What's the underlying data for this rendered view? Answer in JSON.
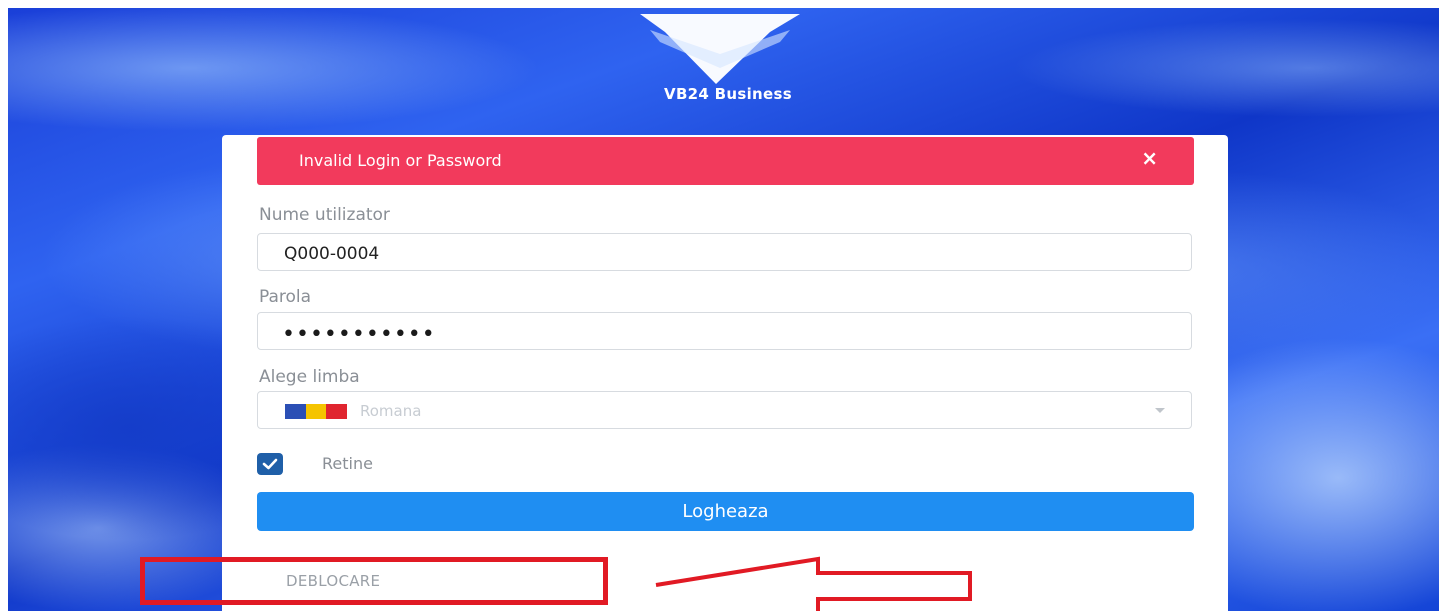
{
  "brand": {
    "name": "VB24 Business"
  },
  "alert": {
    "message": "Invalid Login or Password",
    "close_symbol": "×"
  },
  "form": {
    "username": {
      "label": "Nume utilizator",
      "value": "Q000-0004"
    },
    "password": {
      "label": "Parola",
      "masked_value": "•••••••••••"
    },
    "language": {
      "label": "Alege limba",
      "selected": "Romana",
      "flag_colors": [
        "#2b4fb5",
        "#f5c400",
        "#e0252f"
      ]
    },
    "remember": {
      "label": "Retine",
      "checked": true
    },
    "submit_label": "Logheaza",
    "unlock_link": "DEBLOCARE"
  },
  "colors": {
    "alert": "#f23a5c",
    "primary_button": "#1f8ef2",
    "checkbox": "#1f5fa8",
    "annotation": "#e11a24"
  },
  "icons": {
    "logo": "v-shield-logo",
    "close": "close-icon",
    "caret": "chevron-down-icon",
    "check": "check-icon",
    "arrow": "left-arrow-annotation"
  }
}
